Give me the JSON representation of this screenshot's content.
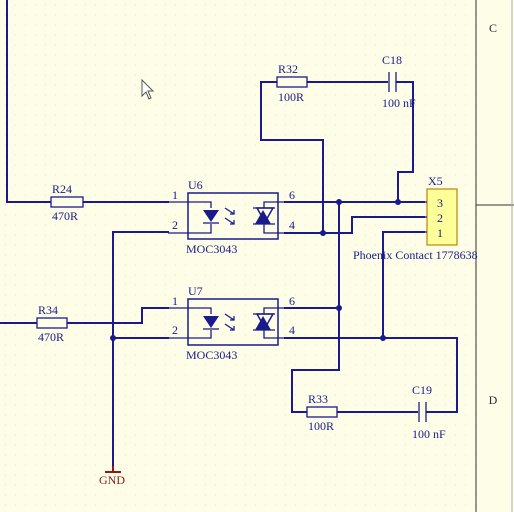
{
  "zones": {
    "c": "C",
    "d": "D"
  },
  "resistors": {
    "r24": {
      "ref": "R24",
      "value": "470R"
    },
    "r32": {
      "ref": "R32",
      "value": "100R"
    },
    "r34": {
      "ref": "R34",
      "value": "470R"
    },
    "r33": {
      "ref": "R33",
      "value": "100R"
    }
  },
  "capacitors": {
    "c18": {
      "ref": "C18",
      "value": "100 nF"
    },
    "c19": {
      "ref": "C19",
      "value": "100 nF"
    }
  },
  "optos": {
    "u6": {
      "ref": "U6",
      "part": "MOC3043",
      "pin1": "1",
      "pin2": "2",
      "pin6": "6",
      "pin4": "4"
    },
    "u7": {
      "ref": "U7",
      "part": "MOC3043",
      "pin1": "1",
      "pin2": "2",
      "pin6": "6",
      "pin4": "4"
    }
  },
  "connector": {
    "ref": "X5",
    "part": "Phoenix Contact 1778638",
    "pins": [
      "3",
      "2",
      "1"
    ]
  },
  "ground": {
    "label": "GND"
  },
  "colors": {
    "sheet": "#fefee8",
    "wire": "#1a1a8c",
    "ground": "#8b1a1a",
    "connector_fill": "#ffff99",
    "grid": "#d8d8c8"
  },
  "icons": {
    "cursor": "mouse-pointer-icon"
  }
}
